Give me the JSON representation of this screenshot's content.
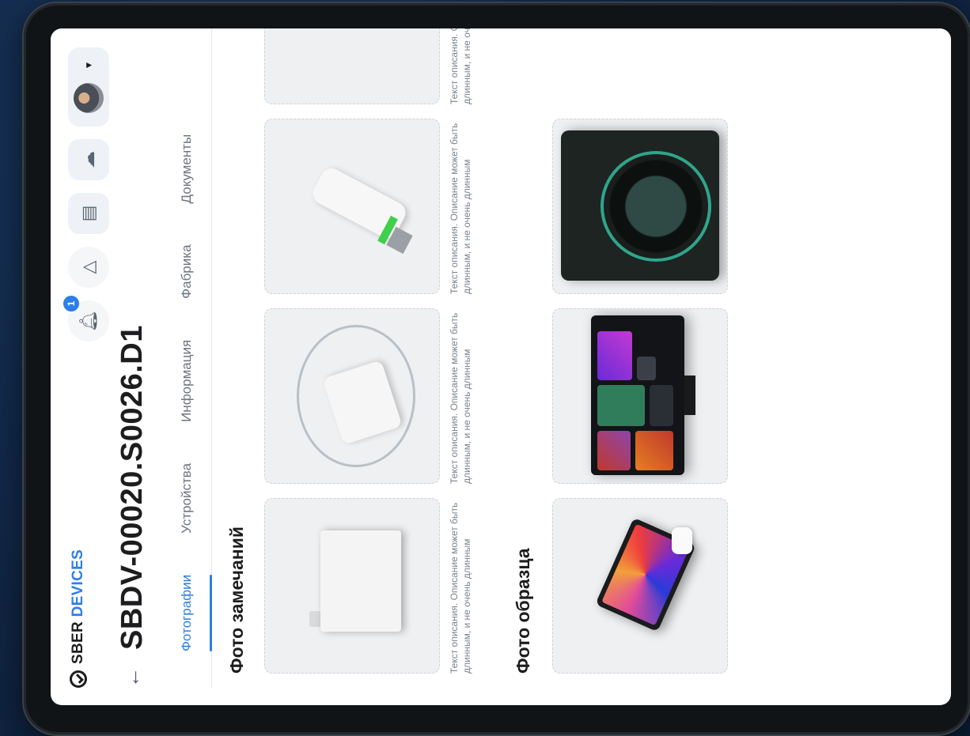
{
  "brand": {
    "part1": "SBER",
    "part2": "DEVICES"
  },
  "header": {
    "back_icon": "arrow-left-icon",
    "title": "SBDV-00020.S0026.D1",
    "notifications_count": "1",
    "actions": [
      "bell-icon",
      "alert-triangle-icon",
      "document-icon",
      "cloud-sync-icon",
      "user-avatar"
    ]
  },
  "tabs": [
    {
      "label": "Фотографии",
      "active": true
    },
    {
      "label": "Устройства",
      "active": false
    },
    {
      "label": "Информация",
      "active": false
    },
    {
      "label": "Фабрика",
      "active": false
    },
    {
      "label": "Документы",
      "active": false
    }
  ],
  "sections": {
    "defects": {
      "title": "Фото замечаний",
      "cards": [
        {
          "desc": "Текст описания. Описание может быть длинным, и не очень длинным"
        },
        {
          "desc": "Текст описания. Описание может быть длинным, и не очень длинным"
        },
        {
          "desc": "Текст описания. Описание может быть длинным, и не очень длинным"
        },
        {
          "desc": "Текст описания. Описание может быть длинным, и не очень длинным"
        }
      ]
    },
    "sample": {
      "title": "Фото образца",
      "cards": [
        {
          "desc": ""
        },
        {
          "desc": ""
        },
        {
          "desc": ""
        }
      ]
    }
  },
  "colors": {
    "accent": "#2c7ee8",
    "background": "#12294a"
  }
}
